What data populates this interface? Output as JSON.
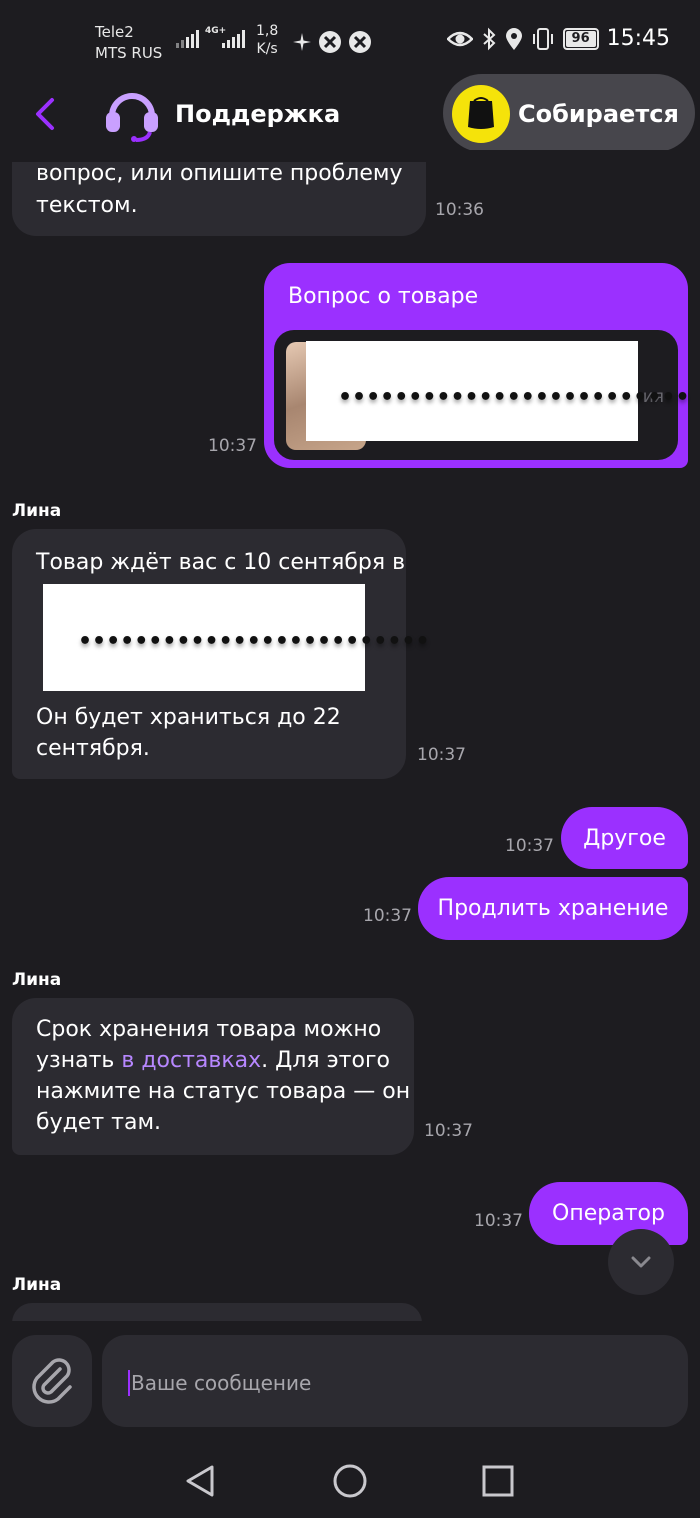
{
  "status_bar": {
    "carrier_line1": "Tele2",
    "carrier_line2": "MTS RUS",
    "network_badge": "4G+",
    "speed_value": "1,8",
    "speed_unit": "K/s",
    "battery": "96",
    "time": "15:45"
  },
  "header": {
    "title": "Поддержка",
    "order_status": "Собирается"
  },
  "messages": [
    {
      "id": "m0",
      "side": "in",
      "text_line1": "вопрос, или опишите проблему",
      "text_line2": "текстом.",
      "time": "10:36"
    },
    {
      "id": "m1",
      "side": "out",
      "title": "Вопрос о товаре",
      "product_tail": "ия",
      "time": "10:37"
    },
    {
      "id": "m2",
      "side": "in",
      "sender": "Лина",
      "text_first": "Товар ждёт вас с 10 сентября в",
      "text_last": "Он будет храниться до 22 сентября.",
      "time": "10:37"
    },
    {
      "id": "m3",
      "side": "out",
      "text": "Другое",
      "time": "10:37"
    },
    {
      "id": "m4",
      "side": "out",
      "text": "Продлить хранение",
      "time": "10:37"
    },
    {
      "id": "m5",
      "side": "in",
      "sender": "Лина",
      "text_line1": "Срок хранения товара можно",
      "text_line2_pre": "узнать ",
      "text_line2_link": "в доставках",
      "text_line2_post": ". Для этого",
      "text_line3": "нажмите на статус товара — он",
      "text_line4": "будет там.",
      "time": "10:37"
    },
    {
      "id": "m6",
      "side": "out",
      "text": "Оператор",
      "time": "10:37"
    },
    {
      "id": "m7",
      "side": "in",
      "sender": "Лина"
    }
  ],
  "redaction_dots": "•••••••••••••••••••••••••",
  "composer": {
    "placeholder": "Ваше сообщение"
  },
  "colors": {
    "background": "#1d1c20",
    "bubble_incoming": "#2c2b31",
    "bubble_outgoing": "#9b30ff",
    "accent": "#9b30ff",
    "link": "#b787ff",
    "status_yellow": "#f5e30a"
  }
}
